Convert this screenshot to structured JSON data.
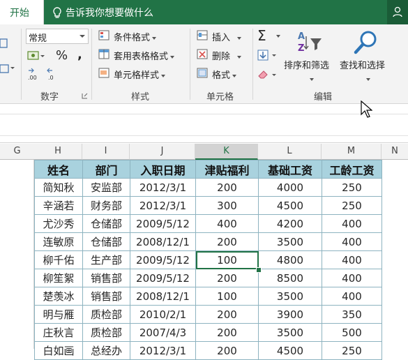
{
  "tabs": {
    "home": "开始",
    "tell_me": "告诉我你想要做什么"
  },
  "ribbon": {
    "number": {
      "format_value": "常规",
      "percent": "%",
      "comma": ",",
      "label": "数字"
    },
    "styles": {
      "conditional": "条件格式",
      "table_format": "套用表格格式",
      "cell_styles": "单元格样式",
      "label": "样式"
    },
    "cells": {
      "insert": "插入",
      "delete": "删除",
      "format": "格式",
      "label": "单元格"
    },
    "editing": {
      "sigma": "Σ",
      "sort_filter": "排序和筛选",
      "find_select": "查找和选择",
      "label": "编辑"
    }
  },
  "columns": [
    "G",
    "H",
    "I",
    "J",
    "K",
    "L",
    "M",
    "N"
  ],
  "table": {
    "headers": [
      "姓名",
      "部门",
      "入职日期",
      "津贴福利",
      "基础工资",
      "工龄工资"
    ],
    "rows": [
      [
        "简知秋",
        "安监部",
        "2012/3/1",
        "200",
        "4000",
        "250"
      ],
      [
        "辛涵若",
        "财务部",
        "2012/3/1",
        "300",
        "4500",
        "250"
      ],
      [
        "尤沙秀",
        "仓储部",
        "2009/5/12",
        "400",
        "4200",
        "400"
      ],
      [
        "连敏原",
        "仓储部",
        "2008/12/1",
        "200",
        "3500",
        "400"
      ],
      [
        "柳千佑",
        "生产部",
        "2009/5/12",
        "100",
        "4800",
        "400"
      ],
      [
        "柳笙絮",
        "销售部",
        "2009/5/12",
        "200",
        "8500",
        "400"
      ],
      [
        "楚羡冰",
        "销售部",
        "2008/12/1",
        "100",
        "3500",
        "400"
      ],
      [
        "明与雁",
        "质检部",
        "2010/2/1",
        "200",
        "3900",
        "350"
      ],
      [
        "庄秋言",
        "质检部",
        "2007/4/3",
        "200",
        "3500",
        "500"
      ],
      [
        "白如画",
        "总经办",
        "2012/3/1",
        "200",
        "4500",
        "250"
      ]
    ]
  },
  "colors": {
    "accent": "#217346",
    "header_fill": "#a9d2de",
    "border": "#8db3c0"
  }
}
